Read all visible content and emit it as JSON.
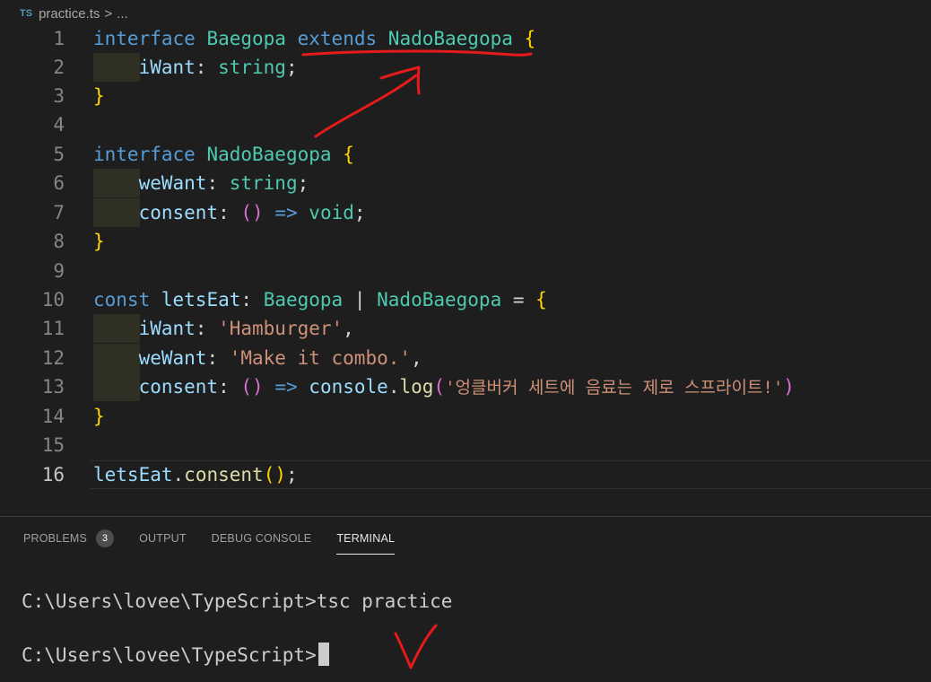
{
  "breadcrumb": {
    "lang_icon": "TS",
    "file": "practice.ts",
    "separator": ">",
    "rest": "..."
  },
  "editor": {
    "active_line": 16,
    "lines": [
      {
        "n": "1"
      },
      {
        "n": "2"
      },
      {
        "n": "3"
      },
      {
        "n": "4"
      },
      {
        "n": "5"
      },
      {
        "n": "6"
      },
      {
        "n": "7"
      },
      {
        "n": "8"
      },
      {
        "n": "9"
      },
      {
        "n": "10"
      },
      {
        "n": "11"
      },
      {
        "n": "12"
      },
      {
        "n": "13"
      },
      {
        "n": "14"
      },
      {
        "n": "15"
      },
      {
        "n": "16"
      }
    ],
    "tokens": {
      "interface": "interface",
      "extends": "extends",
      "const": "const",
      "void": "void",
      "string": "string",
      "Baegopa": "Baegopa",
      "NadoBaegopa": "NadoBaegopa",
      "iWant": "iWant",
      "weWant": "weWant",
      "consent": "consent",
      "letsEat": "letsEat",
      "console": "console",
      "log": "log",
      "str_hamburger": "'Hamburger'",
      "str_combo": "'Make it combo.'",
      "str_korean": "'엉클버커 세트에 음료는 제로 스프라이트!'"
    }
  },
  "panel": {
    "tabs": [
      {
        "label": "PROBLEMS",
        "badge": "3"
      },
      {
        "label": "OUTPUT"
      },
      {
        "label": "DEBUG CONSOLE"
      },
      {
        "label": "TERMINAL"
      }
    ],
    "active_tab": "TERMINAL",
    "terminal_lines": [
      "C:\\Users\\lovee\\TypeScript>tsc practice",
      "C:\\Users\\lovee\\TypeScript>"
    ]
  },
  "colors": {
    "background": "#1e1e1e",
    "keyword": "#569cd6",
    "type": "#4ec9b0",
    "property": "#9cdcfe",
    "string": "#ce9178",
    "function": "#dcdcaa",
    "annotation": "#e51a1a"
  }
}
